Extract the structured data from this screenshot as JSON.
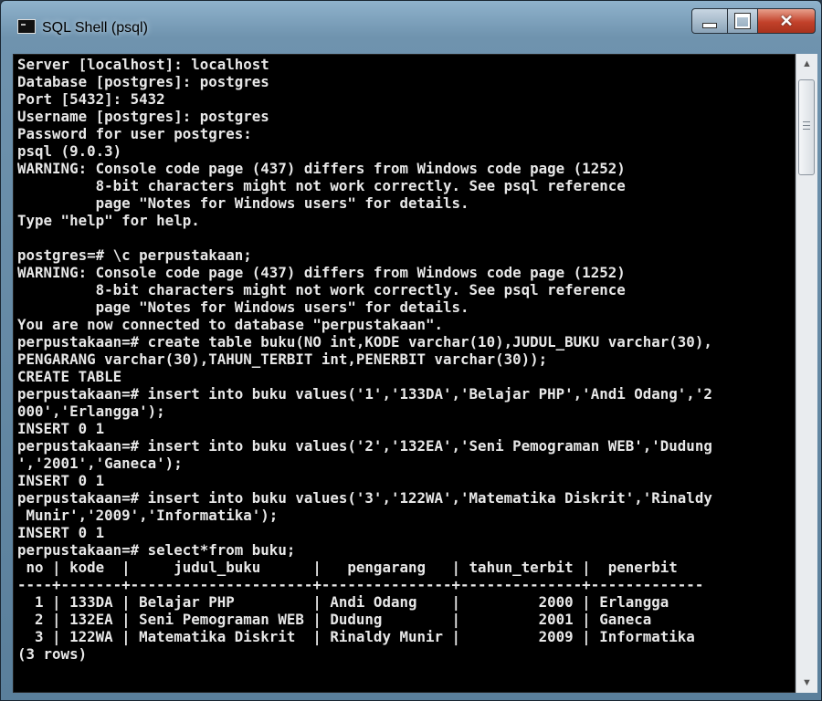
{
  "window": {
    "title": "SQL Shell (psql)",
    "close_symbol": "✕"
  },
  "console": {
    "lines": [
      "Server [localhost]: localhost",
      "Database [postgres]: postgres",
      "Port [5432]: 5432",
      "Username [postgres]: postgres",
      "Password for user postgres:",
      "psql (9.0.3)",
      "WARNING: Console code page (437) differs from Windows code page (1252)",
      "         8-bit characters might not work correctly. See psql reference",
      "         page \"Notes for Windows users\" for details.",
      "Type \"help\" for help.",
      "",
      "postgres=# \\c perpustakaan;",
      "WARNING: Console code page (437) differs from Windows code page (1252)",
      "         8-bit characters might not work correctly. See psql reference",
      "         page \"Notes for Windows users\" for details.",
      "You are now connected to database \"perpustakaan\".",
      "perpustakaan=# create table buku(NO int,KODE varchar(10),JUDUL_BUKU varchar(30),",
      "PENGARANG varchar(30),TAHUN_TERBIT int,PENERBIT varchar(30));",
      "CREATE TABLE",
      "perpustakaan=# insert into buku values('1','133DA','Belajar PHP','Andi Odang','2",
      "000','Erlangga');",
      "INSERT 0 1",
      "perpustakaan=# insert into buku values('2','132EA','Seni Pemograman WEB','Dudung",
      "','2001','Ganeca');",
      "INSERT 0 1",
      "perpustakaan=# insert into buku values('3','122WA','Matematika Diskrit','Rinaldy",
      " Munir','2009','Informatika');",
      "INSERT 0 1",
      "perpustakaan=# select*from buku;",
      " no | kode  |     judul_buku      |   pengarang   | tahun_terbit |  penerbit",
      "----+-------+---------------------+---------------+--------------+-------------",
      "  1 | 133DA | Belajar PHP         | Andi Odang    |         2000 | Erlangga",
      "  2 | 132EA | Seni Pemograman WEB | Dudung        |         2001 | Ganeca",
      "  3 | 122WA | Matematika Diskrit  | Rinaldy Munir |         2009 | Informatika",
      "(3 rows)",
      ""
    ]
  },
  "scrollbar": {
    "up_symbol": "▲",
    "down_symbol": "▼"
  }
}
